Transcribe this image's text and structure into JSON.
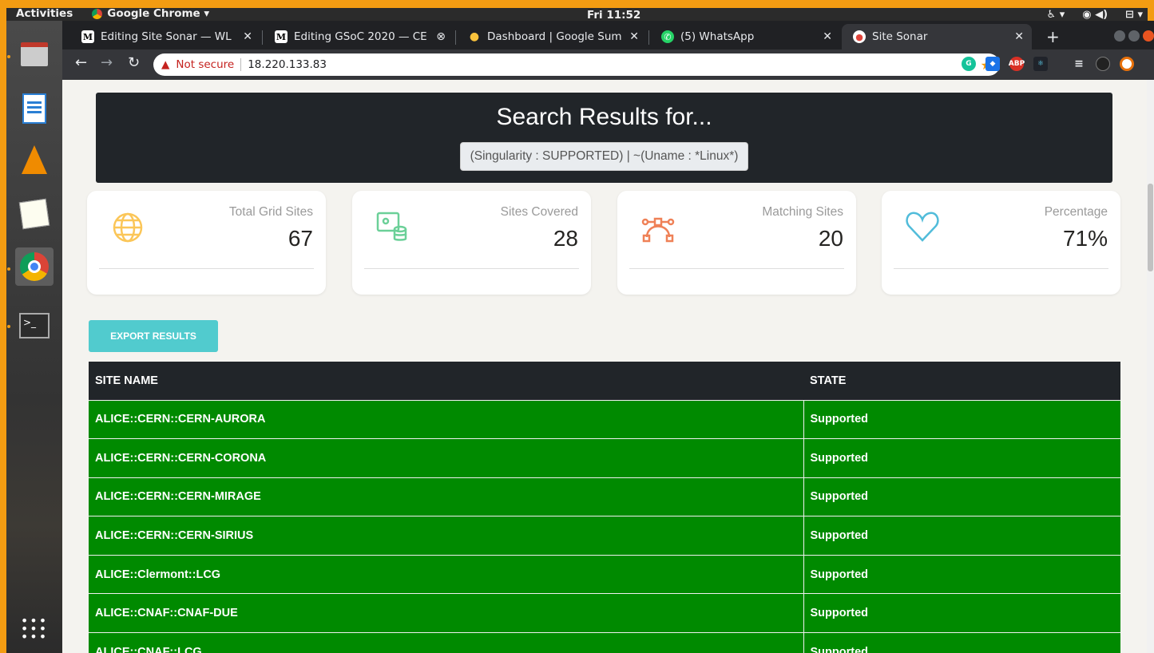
{
  "topbar": {
    "activities": "Activities",
    "app": "Google Chrome ▾",
    "clock": "Fri 11:52",
    "tray": [
      "♿ ▾",
      "◉ ◀)",
      "⊟ ▾"
    ]
  },
  "tabs": [
    {
      "label": "Editing Site Sonar — WL",
      "icon": "M"
    },
    {
      "label": "Editing GSoC 2020 — CE",
      "icon": "M"
    },
    {
      "label": "Dashboard | Google Sum",
      "icon": "●"
    },
    {
      "label": "(5) WhatsApp",
      "icon": "✆"
    },
    {
      "label": "Site Sonar",
      "icon": "●"
    }
  ],
  "address": {
    "warning": "Not secure",
    "url": "18.220.133.83"
  },
  "banner": {
    "title": "Search Results for...",
    "query": "(Singularity : SUPPORTED) | ~(Uname : *Linux*)"
  },
  "cards": [
    {
      "label": "Total Grid Sites",
      "value": "67",
      "icon": "globe-icon",
      "color": "#fbc658"
    },
    {
      "label": "Sites Covered",
      "value": "28",
      "icon": "database-icon",
      "color": "#6bd098"
    },
    {
      "label": "Matching Sites",
      "value": "20",
      "icon": "vector-icon",
      "color": "#ef8157"
    },
    {
      "label": "Percentage",
      "value": "71%",
      "icon": "heart-icon",
      "color": "#51bcda"
    }
  ],
  "export_label": "EXPORT RESULTS",
  "table": {
    "headers": [
      "SITE NAME",
      "STATE"
    ],
    "rows": [
      [
        "ALICE::CERN::CERN-AURORA",
        "Supported"
      ],
      [
        "ALICE::CERN::CERN-CORONA",
        "Supported"
      ],
      [
        "ALICE::CERN::CERN-MIRAGE",
        "Supported"
      ],
      [
        "ALICE::CERN::CERN-SIRIUS",
        "Supported"
      ],
      [
        "ALICE::Clermont::LCG",
        "Supported"
      ],
      [
        "ALICE::CNAF::CNAF-DUE",
        "Supported"
      ],
      [
        "ALICE::CNAF::LCG",
        "Supported"
      ]
    ]
  },
  "colors": {
    "row_green": "#008a00",
    "header_dark": "#212529",
    "export_teal": "#51cbce"
  }
}
